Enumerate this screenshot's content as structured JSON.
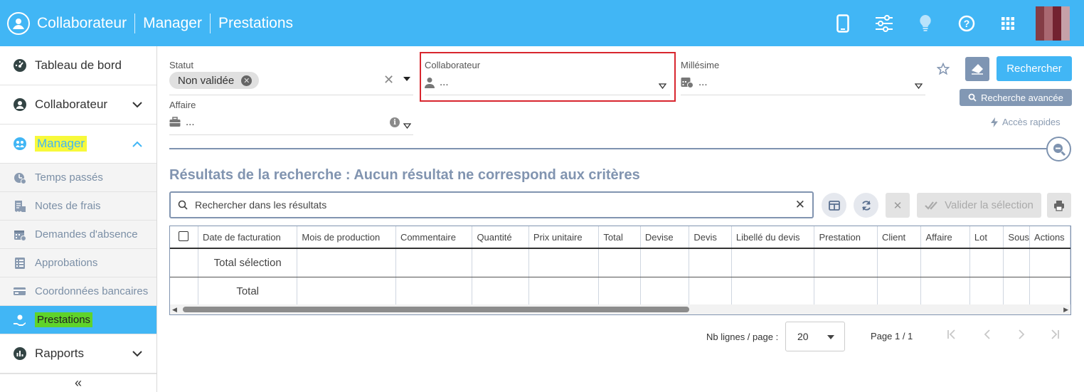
{
  "header": {
    "crumbs": [
      "Collaborateur",
      "Manager",
      "Prestations"
    ],
    "icons": [
      "mobile-icon",
      "sliders-icon",
      "lightbulb-icon",
      "help-icon",
      "apps-grid-icon"
    ]
  },
  "sidebar": {
    "items": [
      {
        "label": "Tableau de bord",
        "icon": "dashboard-icon"
      },
      {
        "label": "Collaborateur",
        "icon": "user-circle-icon"
      },
      {
        "label": "Manager",
        "icon": "manager-icon"
      }
    ],
    "sub_items": [
      {
        "label": "Temps passés",
        "icon": "time-icon"
      },
      {
        "label": "Notes de frais",
        "icon": "receipt-icon"
      },
      {
        "label": "Demandes d'absence",
        "icon": "calendar-icon"
      },
      {
        "label": "Approbations",
        "icon": "list-icon"
      },
      {
        "label": "Coordonnées bancaires",
        "icon": "bank-card-icon"
      },
      {
        "label": "Prestations",
        "icon": "service-icon"
      }
    ],
    "rapports": "Rapports",
    "collapse": "«"
  },
  "filters": {
    "statut_label": "Statut",
    "statut_chip": "Non validée",
    "collaborateur_label": "Collaborateur",
    "collaborateur_value": "...",
    "millesime_label": "Millésime",
    "millesime_value": "...",
    "affaire_label": "Affaire",
    "affaire_value": "..."
  },
  "actions": {
    "search": "Rechercher",
    "advanced": "Recherche avancée",
    "quick": "Accès rapides"
  },
  "results": {
    "title": "Résultats de la recherche : Aucun résultat ne correspond aux critères",
    "search_placeholder": "Rechercher dans les résultats",
    "validate": "Valider la sélection"
  },
  "table": {
    "columns": [
      "Date de facturation",
      "Mois de production",
      "Commentaire",
      "Quantité",
      "Prix unitaire",
      "Total",
      "Devise",
      "Devis",
      "Libellé du devis",
      "Prestation",
      "Client",
      "Affaire",
      "Lot",
      "Sous",
      "Actions"
    ],
    "rows": [
      "Total sélection",
      "Total"
    ]
  },
  "pagination": {
    "label": "Nb lignes / page :",
    "page_size": "20",
    "page": "Page 1 / 1"
  }
}
